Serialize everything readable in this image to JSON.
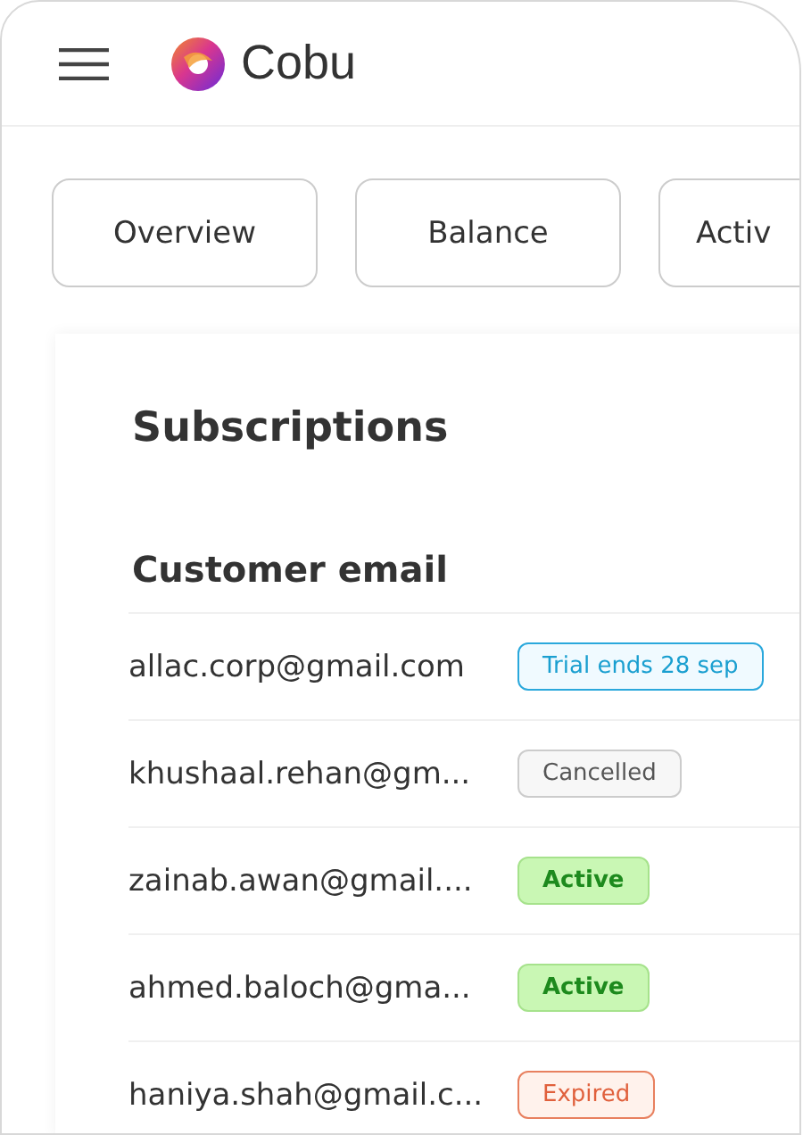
{
  "header": {
    "brand": "Cobu"
  },
  "tabs": [
    {
      "label": "Overview"
    },
    {
      "label": "Balance"
    },
    {
      "label": "Activ"
    }
  ],
  "subscriptions": {
    "title": "Subscriptions",
    "column_header": "Customer email",
    "rows": [
      {
        "email": "allac.corp@gmail.com",
        "status": "Trial ends 28 sep",
        "kind": "trial"
      },
      {
        "email": "khushaal.rehan@gm...",
        "status": "Cancelled",
        "kind": "cancelled"
      },
      {
        "email": "zainab.awan@gmail....",
        "status": "Active",
        "kind": "active"
      },
      {
        "email": "ahmed.baloch@gma...",
        "status": "Active",
        "kind": "active"
      },
      {
        "email": "haniya.shah@gmail.c...",
        "status": "Expired",
        "kind": "expired"
      }
    ]
  }
}
